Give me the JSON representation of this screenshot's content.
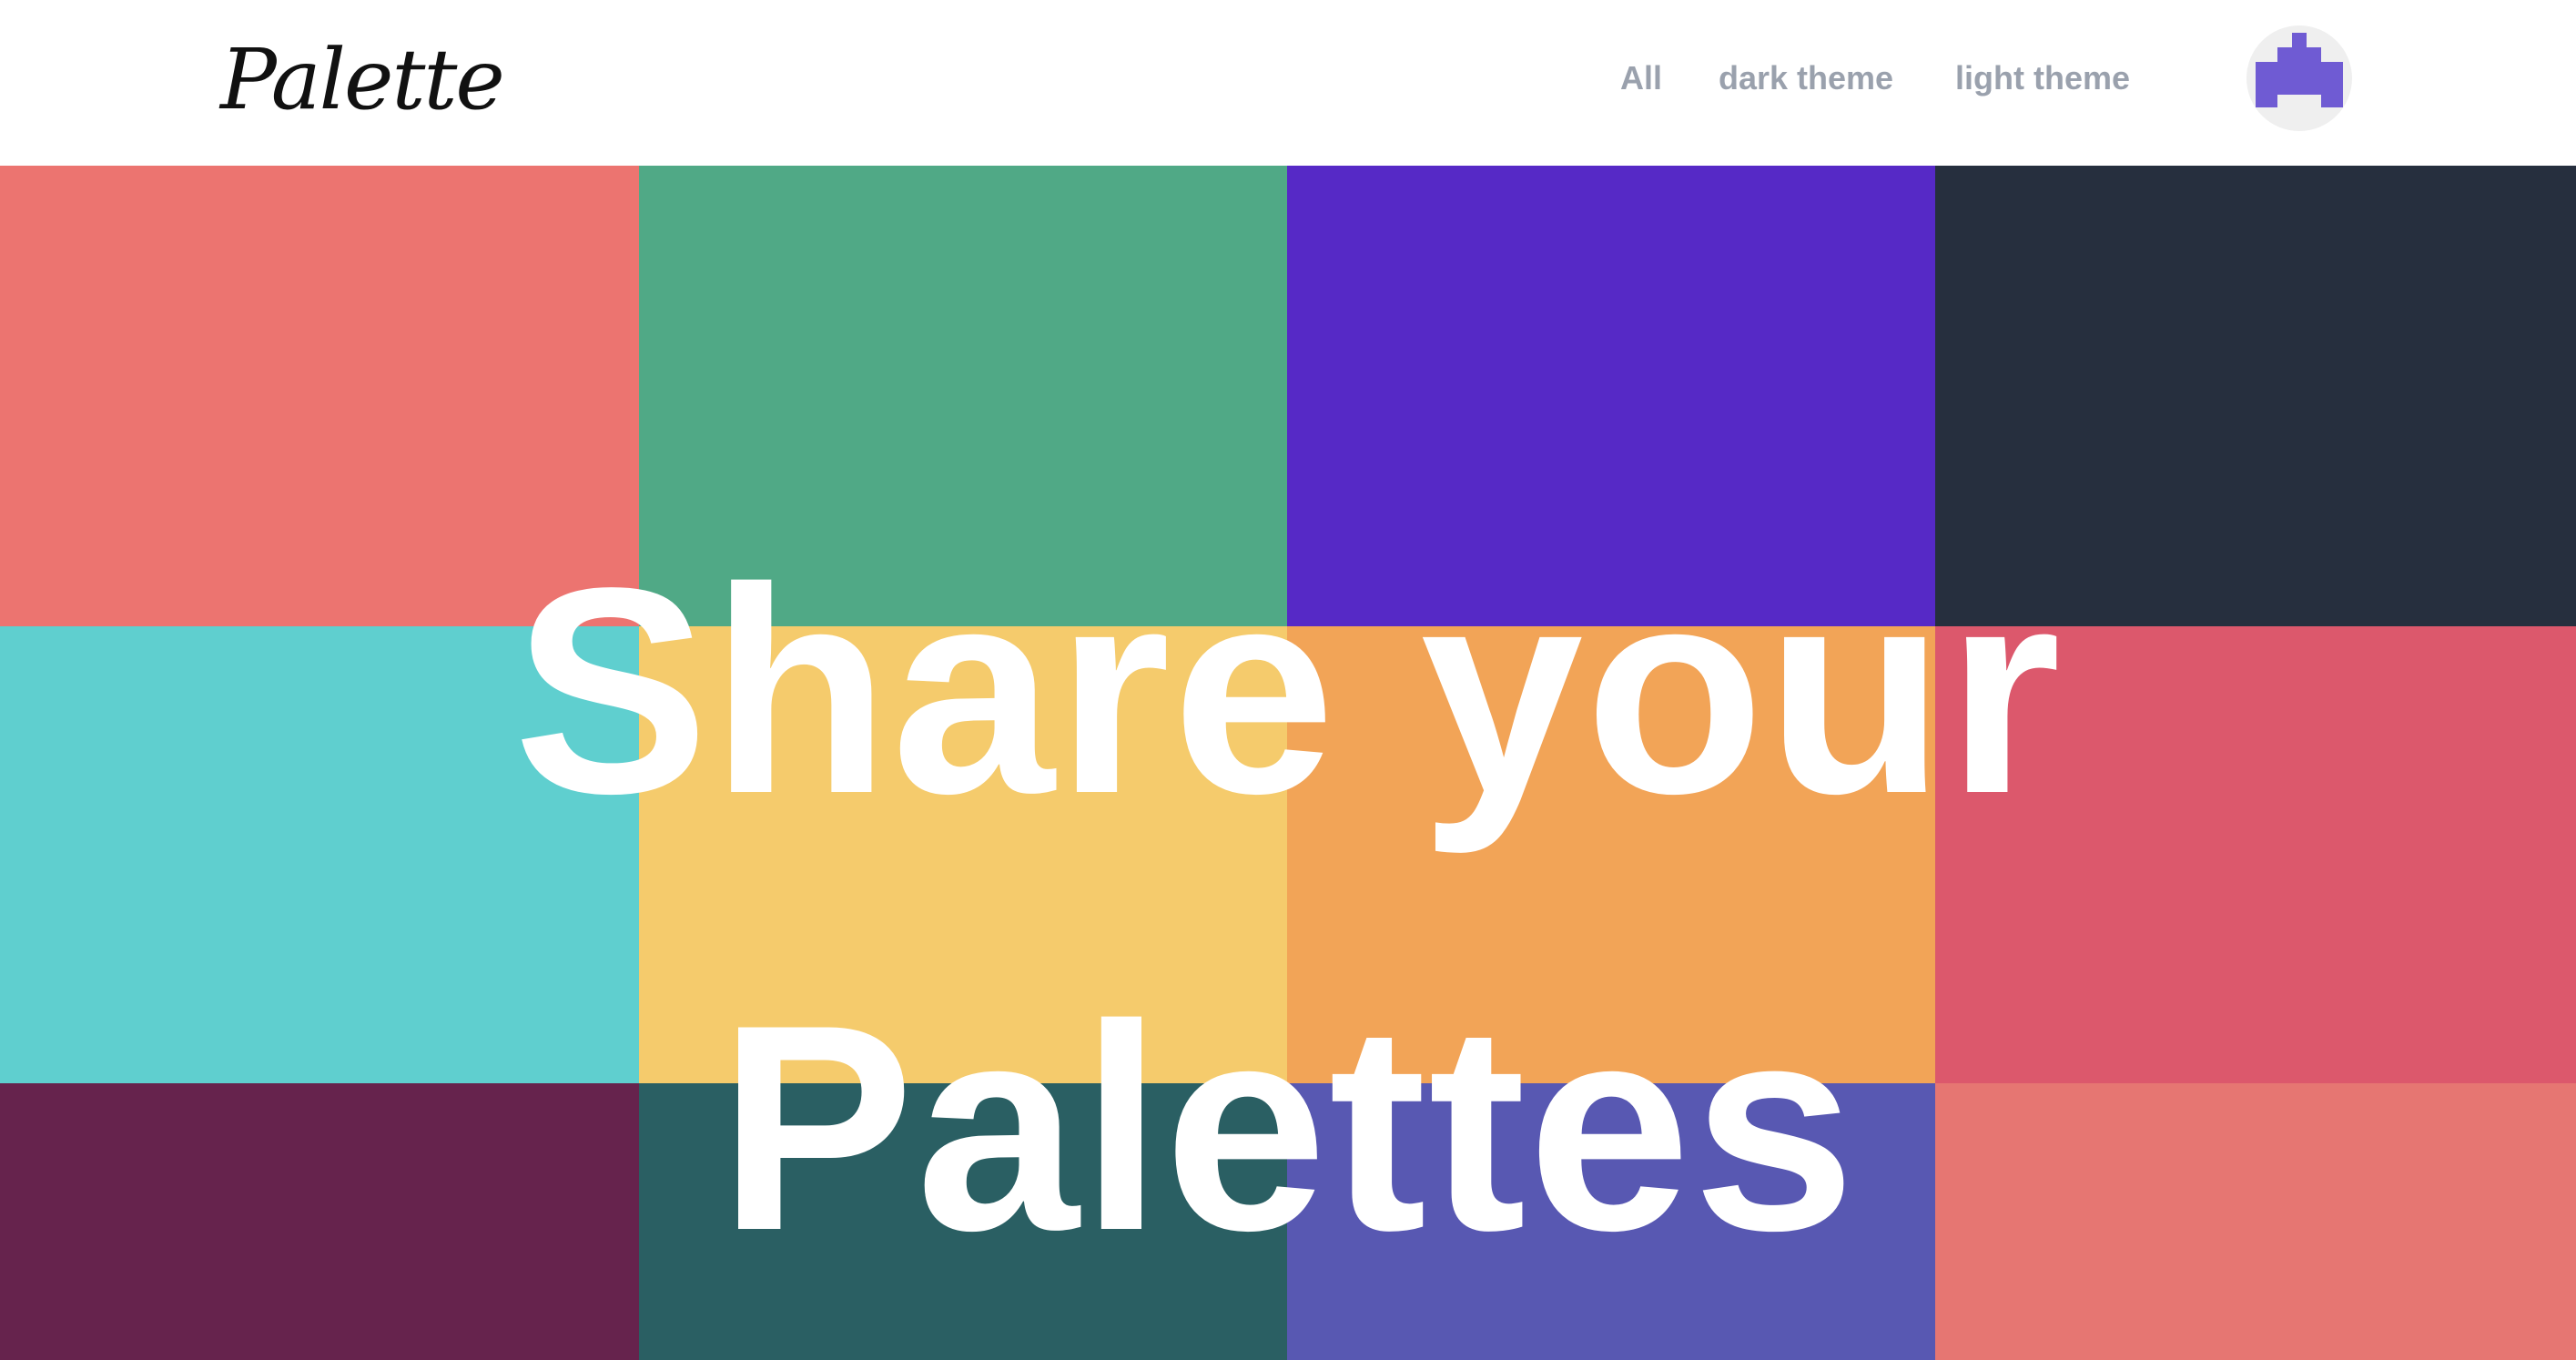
{
  "header": {
    "logo": "Palette",
    "nav": {
      "all": "All",
      "dark": "dark theme",
      "light": "light theme"
    },
    "avatar_icon": "pixel-avatar-icon",
    "avatar_color": "#6f5bd3"
  },
  "grid": {
    "colors": [
      [
        "#ec7470",
        "#50a986",
        "#5629c6",
        "#262f3e"
      ],
      [
        "#5fcfcf",
        "#f5cb6c",
        "#f2a457",
        "#dc586c"
      ],
      [
        "#66234d",
        "#2a5f63",
        "#5858b2",
        "#e67672"
      ]
    ]
  },
  "hero": {
    "line1": "Share your",
    "line2": "Palettes"
  }
}
